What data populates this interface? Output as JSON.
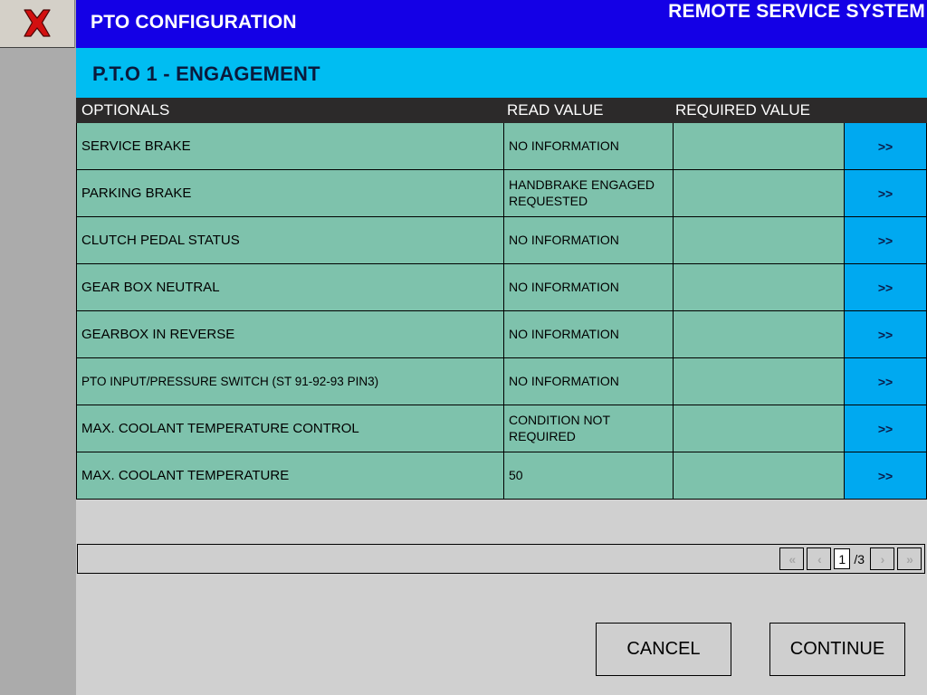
{
  "window": {
    "app_title": "PTO CONFIGURATION",
    "system_title": "REMOTE SERVICE SYSTEM",
    "section_title": "P.T.O 1 - ENGAGEMENT",
    "close_icon": "close-x-icon"
  },
  "colors": {
    "titlebar": "#1400e6",
    "subtitlebar": "#00bdf2",
    "grid_header": "#2c2a2a",
    "grid_row": "#7ec2ac",
    "action_button": "#00a9f0",
    "page_background": "#d0d0d0",
    "rail_background": "#ababab",
    "close_x": "#d21010"
  },
  "table": {
    "columns": [
      "OPTIONALS",
      "READ VALUE",
      "REQUIRED VALUE"
    ],
    "row_action_label": ">>",
    "rows": [
      {
        "optional": "SERVICE BRAKE",
        "read_value": "NO INFORMATION",
        "required_value": "",
        "action": ">>"
      },
      {
        "optional": "PARKING BRAKE",
        "read_value": "HANDBRAKE ENGAGED REQUESTED",
        "required_value": "",
        "action": ">>"
      },
      {
        "optional": "CLUTCH PEDAL STATUS",
        "read_value": "NO INFORMATION",
        "required_value": "",
        "action": ">>"
      },
      {
        "optional": "GEAR BOX NEUTRAL",
        "read_value": "NO INFORMATION",
        "required_value": "",
        "action": ">>"
      },
      {
        "optional": "GEARBOX IN REVERSE",
        "read_value": "NO INFORMATION",
        "required_value": "",
        "action": ">>"
      },
      {
        "optional": "PTO INPUT/PRESSURE SWITCH (ST 91-92-93 PIN3)",
        "read_value": "NO INFORMATION",
        "required_value": "",
        "action": ">>"
      },
      {
        "optional": "MAX. COOLANT TEMPERATURE CONTROL",
        "read_value": "CONDITION NOT REQUIRED",
        "required_value": "",
        "action": ">>"
      },
      {
        "optional": "MAX. COOLANT TEMPERATURE",
        "read_value": "50",
        "required_value": "",
        "action": ">>"
      }
    ]
  },
  "pager": {
    "first_label": "«",
    "prev_label": "‹",
    "current_page": "1",
    "total_pages": "/3",
    "next_label": "›",
    "last_label": "»"
  },
  "footer": {
    "cancel_label": "CANCEL",
    "continue_label": "CONTINUE"
  }
}
